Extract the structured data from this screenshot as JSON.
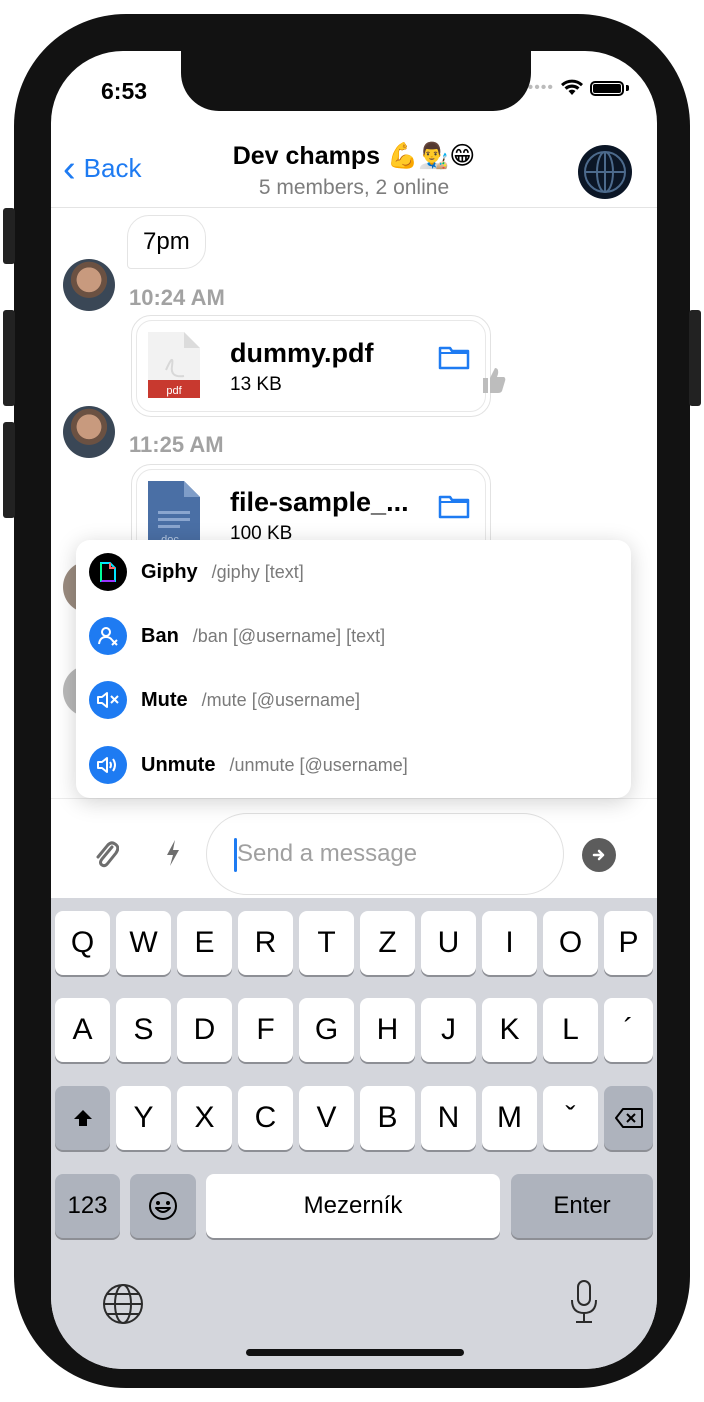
{
  "status": {
    "time": "6:53"
  },
  "nav": {
    "back_label": "Back",
    "title": "Dev champs 💪👨‍🎨😁",
    "subtitle": "5 members, 2 online"
  },
  "messages": {
    "text_bubble": "7pm",
    "time1": "10:24 AM",
    "file1": {
      "name": "dummy.pdf",
      "size": "13 KB",
      "type_label": "pdf"
    },
    "time2": "11:25 AM",
    "file2": {
      "name": "file-sample_...",
      "size": "100 KB",
      "type_label": "doc"
    }
  },
  "commands": [
    {
      "name": "Giphy",
      "args": "/giphy [text]",
      "icon": "giphy-icon"
    },
    {
      "name": "Ban",
      "args": "/ban [@username] [text]",
      "icon": "ban-user-icon"
    },
    {
      "name": "Mute",
      "args": "/mute [@username]",
      "icon": "mute-icon"
    },
    {
      "name": "Unmute",
      "args": "/unmute [@username]",
      "icon": "unmute-icon"
    }
  ],
  "composer": {
    "placeholder": "Send a message"
  },
  "keyboard": {
    "row1": [
      "Q",
      "W",
      "E",
      "R",
      "T",
      "Z",
      "U",
      "I",
      "O",
      "P"
    ],
    "row2": [
      "A",
      "S",
      "D",
      "F",
      "G",
      "H",
      "J",
      "K",
      "L",
      "´"
    ],
    "row3": [
      "Y",
      "X",
      "C",
      "V",
      "B",
      "N",
      "M",
      "ˇ"
    ],
    "numbers_label": "123",
    "space_label": "Mezerník",
    "enter_label": "Enter"
  },
  "colors": {
    "accent": "#1e7bf2",
    "command_icon_bg": "#1e7bf2",
    "keyboard_bg": "#d4d6dc"
  }
}
